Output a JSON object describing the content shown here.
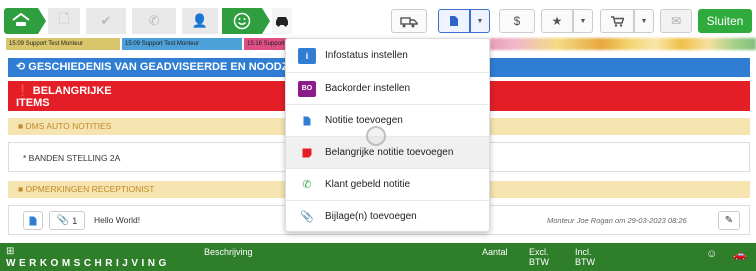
{
  "toolbar": {
    "sluiten_label": "Sluiten"
  },
  "tickets": [
    {
      "label": "15:09 Support Test Monteur"
    },
    {
      "label": "15:09 Support Test Monteur"
    },
    {
      "label": "15:16 Support"
    }
  ],
  "sections": {
    "history_title": "GESCHIEDENIS VAN GEADVISEERDE EN NOODZ",
    "important_title_line1": "BELANGRIJKE",
    "important_title_line2": "ITEMS",
    "dms_title": "DMS AUTO NOTITIES",
    "dms_note": "* BANDEN STELLING 2A",
    "recept_title": "OPMERKINGEN RECEPTIONIST",
    "attach_count": "1",
    "note_text": "Hello World!",
    "note_meta": "Monteur Joe Rogan om 29-03-2023 08:26"
  },
  "werk": {
    "title": "WERKOMSCHRIJVING",
    "col_beschrijving": "Beschrijving",
    "col_aantal": "Aantal",
    "col_excl": "Excl.",
    "col_excl2": "BTW",
    "col_incl": "Incl.",
    "col_incl2": "BTW"
  },
  "menu": {
    "items": [
      {
        "label": "Infostatus instellen",
        "icon": "info-icon",
        "color": "#2f7ed3"
      },
      {
        "label": "Backorder instellen",
        "icon": "bo-badge",
        "color": "#8b1d8b"
      },
      {
        "label": "Notitie toevoegen",
        "icon": "document-icon",
        "color": "#2f7ed3"
      },
      {
        "label": "Belangrijke notitie toevoegen",
        "icon": "note-red-icon",
        "color": "#e41e27"
      },
      {
        "label": "Klant gebeld notitie",
        "icon": "phone-icon",
        "color": "#2fab3d"
      },
      {
        "label": "Bijlage(n) toevoegen",
        "icon": "paperclip-icon",
        "color": "#2f7ed3"
      }
    ],
    "bo_text": "BO"
  }
}
